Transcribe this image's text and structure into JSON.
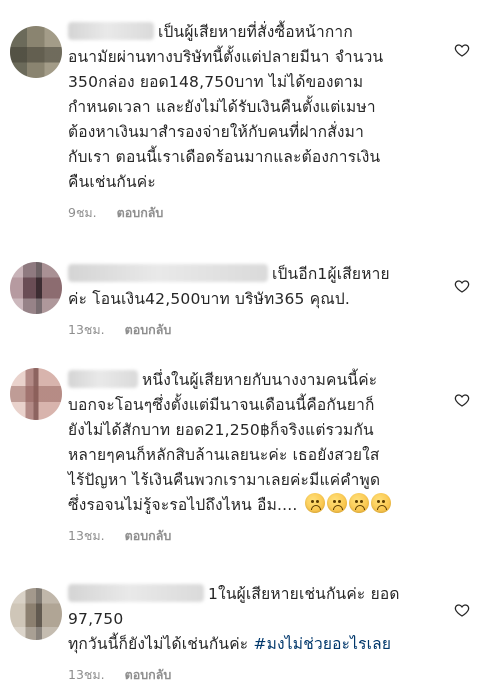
{
  "comments": [
    {
      "lines": [
        "เป็นผู้เสียหายที่สั่งซื้อหน้ากาก",
        "อนามัยผ่านทางบริษัทนี้ตั้งแต่ปลายมีนา จำนวน",
        "350กล่อง ยอด148,750บาท ไม่ได้ของตาม",
        "กำหนดเวลา และยังไม่ได้รับเงินคืนตั้งแต่เมษา",
        "ต้องหาเงินมาสำรองจ่ายให้กับคนที่ฝากสั่งมา",
        "กับเรา ตอนนี้เราเดือดร้อนมากและต้องการเงิน",
        "คืนเช่นกันค่ะ"
      ],
      "time": "9ชม.",
      "reply_label": "ตอบกลับ",
      "avatar_colors": [
        "#6b6a5a",
        "#8a8470",
        "#4c4a3f",
        "#a39c88"
      ]
    },
    {
      "lines": [
        "เป็นอีก1ผู้เสียหาย",
        "ค่ะ โอนเงิน42,500บาท บริษัท365 คุณป."
      ],
      "time": "13ชม.",
      "reply_label": "ตอบกลับ",
      "avatar_colors": [
        "#6a4d55",
        "#8c6c70",
        "#3d2d32",
        "#b69aa0"
      ]
    },
    {
      "lines": [
        "หนึ่งในผู้เสียหายกับนางงามคนนี้ค่ะ",
        "บอกจะโอนๆซึ่งตั้งแต่มีนาจนเดือนนี้คือกันยาก็",
        "ยังไม่ได้สักบาท ยอด21,250฿ก็จริงแต่รวมกัน",
        "หลายๆคนก็หลักสิบล้านเลยนะค่ะ เธอยังสวยใส",
        "ไร้ปัญหา ไร้เงินคืนพวกเรามาเลยค่ะมีแค่คำพูด",
        "ซึ่งรอจนไม่รู้จะรอไปถึงไหน อืม...."
      ],
      "time": "13ชม.",
      "reply_label": "ตอบกลับ",
      "avatar_colors": [
        "#b38a86",
        "#d8b4ad",
        "#8d6460",
        "#e9d2cc"
      ]
    },
    {
      "lines": [
        "1ในผู้เสียหายเช่นกันค่ะ ยอด",
        "97,750",
        "ทุกวันนี้ก็ยังไม่ได้เช่นกันค่ะ"
      ],
      "hashtag": "#มงไม่ช่วยอะไรเลย",
      "time": "13ชม.",
      "reply_label": "ตอบกลับ",
      "avatar_colors": [
        "#8c8070",
        "#b0a595",
        "#625a50",
        "#cfc6b8"
      ]
    }
  ],
  "icons": {
    "like": "heart-outline-icon",
    "emoji": "frowning-face-icon"
  }
}
